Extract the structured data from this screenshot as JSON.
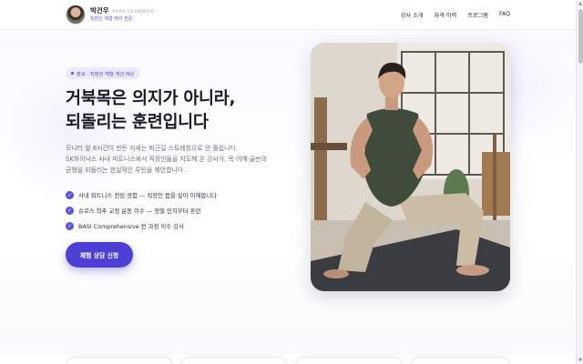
{
  "brand": {
    "name": "박건우",
    "name_en": "PARK GEONWOO",
    "tagline": "직장인 체형 케어 전문"
  },
  "nav": {
    "items": [
      {
        "label": "강사 소개"
      },
      {
        "label": "자격·이력"
      },
      {
        "label": "프로그램"
      },
      {
        "label": "FAQ"
      }
    ]
  },
  "hero": {
    "badge": "판교 · 직장인 체형 개선 레슨",
    "headline_line1": "거북목은 의지가 아니라,",
    "headline_line2": "되돌리는 훈련입니다",
    "desc_line1": "모니터 앞 8시간이 만든 자세는 퇴근길 스트레칭으로 안 풀립니다.",
    "desc_line2": "SK하이닉스 사내 피트니스에서 직장인들을 지도해 온 강사가, 목·어깨·골반의",
    "desc_line3": "균형을 되돌리는 현실적인 루틴을 제안합니다.",
    "checks": [
      {
        "text": "사내 피트니스 전임 경험 — 직장인 몸을 깊이 이해합니다"
      },
      {
        "text": "슈로스 척추 교정 운동 이수 — 정렬 인지부터 훈련"
      },
      {
        "text": "BASI Comprehensive 전 과정 이수 강사"
      }
    ],
    "cta": "체험 상담 신청"
  },
  "colors": {
    "accent": "#4b3fd4",
    "badge_bg": "#ece9ff",
    "text_dark": "#181a29",
    "text_muted": "#6a6e7e"
  },
  "icons": {
    "check": "check-circle-icon"
  }
}
